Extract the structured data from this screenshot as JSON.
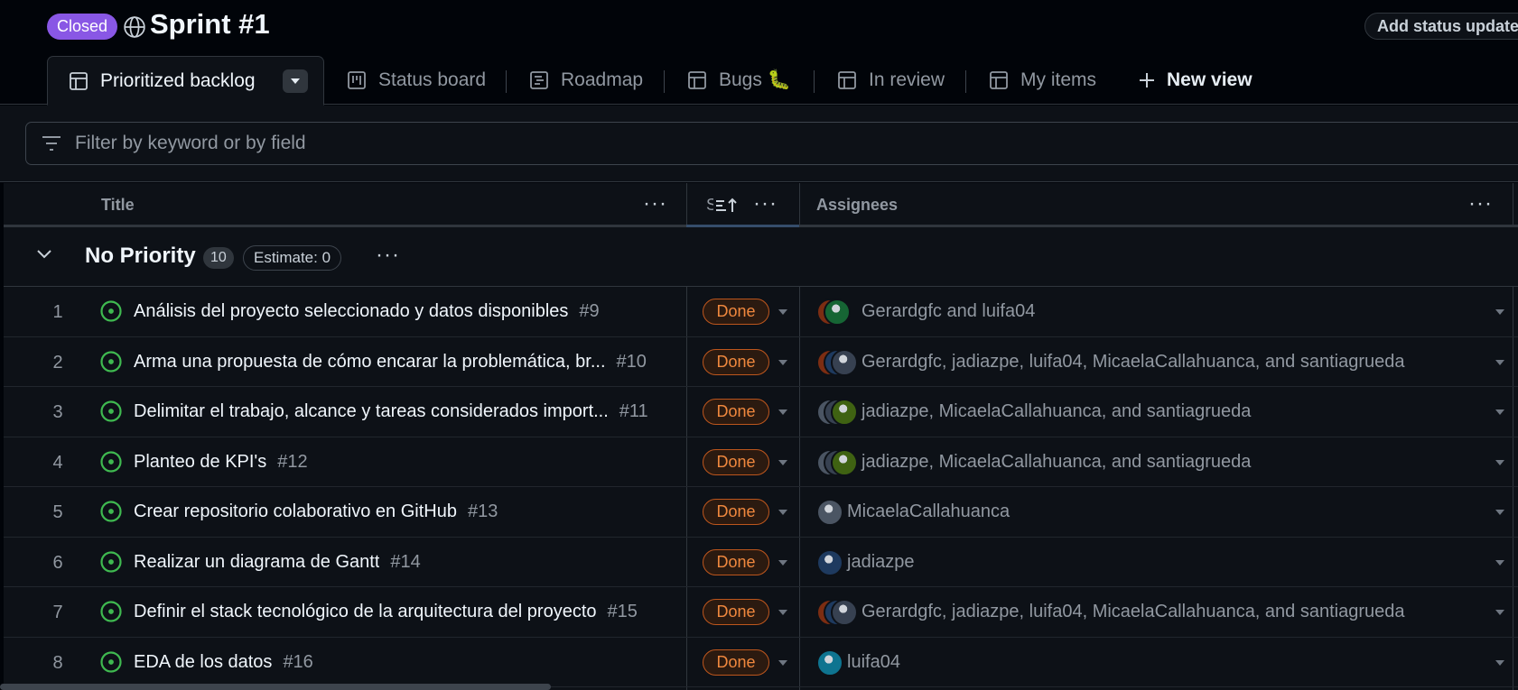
{
  "header": {
    "state_badge": "Closed",
    "title": "Sprint #1",
    "status_update_label": "Add status update"
  },
  "tabs": [
    {
      "label": "Prioritized backlog",
      "icon": "table-icon"
    },
    {
      "label": "Status board",
      "icon": "board-icon"
    },
    {
      "label": "Roadmap",
      "icon": "roadmap-icon"
    },
    {
      "label": "Bugs 🐛",
      "icon": "table-icon"
    },
    {
      "label": "In review",
      "icon": "table-icon"
    },
    {
      "label": "My items",
      "icon": "table-icon"
    },
    {
      "label": "New view",
      "icon": "plus-icon"
    }
  ],
  "filter": {
    "placeholder": "Filter by keyword or by field"
  },
  "columns": {
    "title": "Title",
    "status_short": "S",
    "assignees": "Assignees"
  },
  "group": {
    "name": "No Priority",
    "count": "10",
    "estimate": "Estimate: 0"
  },
  "rows": [
    {
      "num": "1",
      "title": "Análisis del proyecto seleccionado y datos disponibles",
      "ref": "#9",
      "status": "Done",
      "assignees": "Gerardgfc and luifa04"
    },
    {
      "num": "2",
      "title": "Arma una propuesta de cómo encarar la problemática, br...",
      "ref": "#10",
      "status": "Done",
      "assignees": "Gerardgfc, jadiazpe, luifa04, MicaelaCallahuanca, and santiagrueda"
    },
    {
      "num": "3",
      "title": "Delimitar el trabajo, alcance y tareas considerados import...",
      "ref": "#11",
      "status": "Done",
      "assignees": "jadiazpe, MicaelaCallahuanca, and santiagrueda"
    },
    {
      "num": "4",
      "title": "Planteo de KPI's",
      "ref": "#12",
      "status": "Done",
      "assignees": "jadiazpe, MicaelaCallahuanca, and santiagrueda"
    },
    {
      "num": "5",
      "title": "Crear repositorio colaborativo en GitHub",
      "ref": "#13",
      "status": "Done",
      "assignees": "MicaelaCallahuanca"
    },
    {
      "num": "6",
      "title": "Realizar un diagrama de Gantt",
      "ref": "#14",
      "status": "Done",
      "assignees": "jadiazpe"
    },
    {
      "num": "7",
      "title": "Definir el stack tecnológico de la arquitectura del proyecto",
      "ref": "#15",
      "status": "Done",
      "assignees": "Gerardgfc, jadiazpe, luifa04, MicaelaCallahuanca, and santiagrueda"
    },
    {
      "num": "8",
      "title": "EDA de los datos",
      "ref": "#16",
      "status": "Done",
      "assignees": "luifa04"
    }
  ],
  "colors": {
    "closed_badge": "#8957e5",
    "done_text": "#f0883e",
    "done_border": "#bd561d",
    "issue_open": "#3fb950"
  }
}
